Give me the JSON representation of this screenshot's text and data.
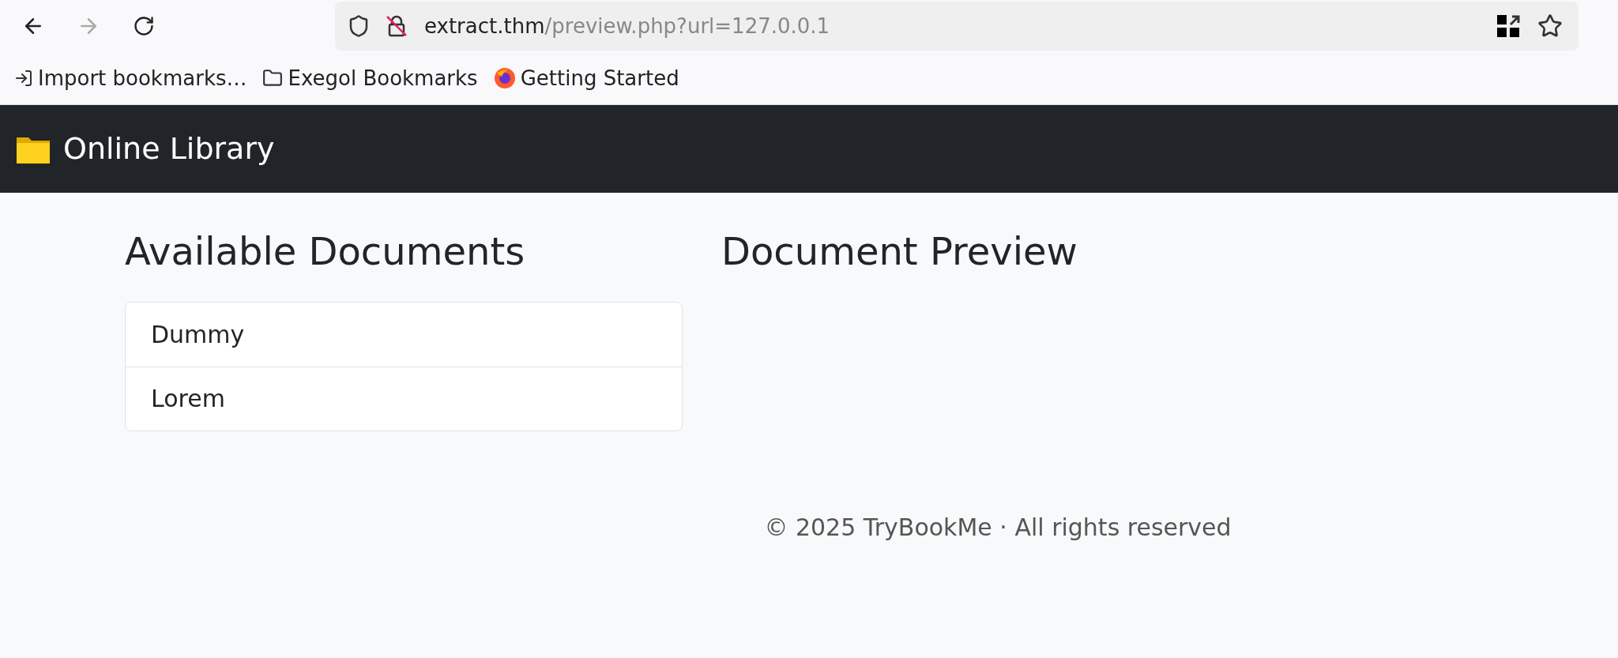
{
  "browser": {
    "url_host": "extract.thm",
    "url_path": "/preview.php?url=127.0.0.1",
    "back_disabled": false,
    "forward_disabled": true
  },
  "bookmarks": [
    {
      "kind": "import",
      "label": "Import bookmarks…"
    },
    {
      "kind": "folder",
      "label": "Exegol Bookmarks"
    },
    {
      "kind": "browser",
      "label": "Getting Started"
    }
  ],
  "navbar": {
    "title": "Online Library"
  },
  "documents": {
    "heading": "Available Documents",
    "items": [
      "Dummy",
      "Lorem"
    ]
  },
  "preview": {
    "heading": "Document Preview"
  },
  "footer": "© 2025 TryBookMe · All rights reserved"
}
